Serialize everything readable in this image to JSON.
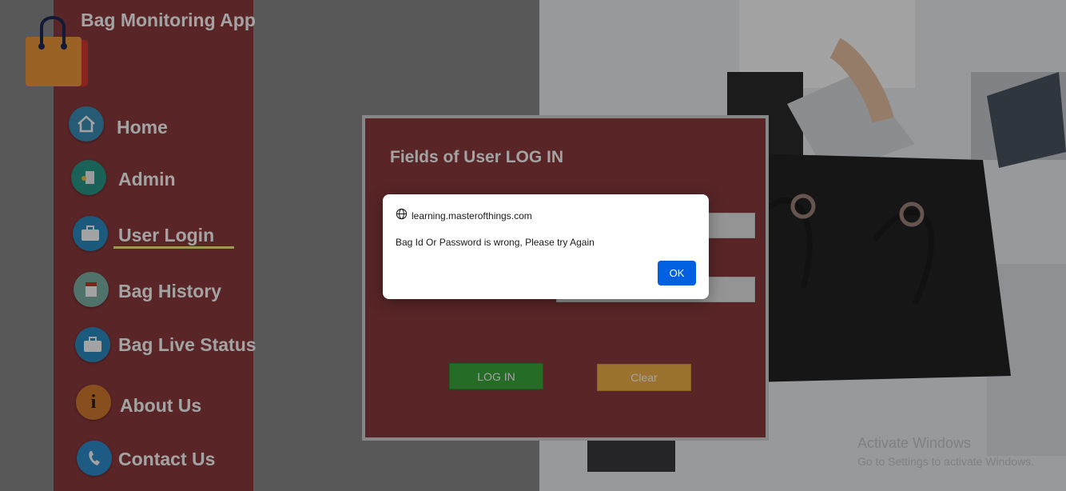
{
  "app": {
    "title": "Bag Monitoring App"
  },
  "sidebar": {
    "items": [
      {
        "label": "Home",
        "icon": "house-icon",
        "color": "#3c8fb8"
      },
      {
        "label": "Admin",
        "icon": "door-key-icon",
        "color": "#2a9a8a"
      },
      {
        "label": "User Login",
        "icon": "briefcase-icon",
        "color": "#2b8ec4",
        "active": true
      },
      {
        "label": "Bag History",
        "icon": "notepad-icon",
        "color": "#7fb3a8"
      },
      {
        "label": "Bag Live Status",
        "icon": "briefcase-icon",
        "color": "#2b8ec4"
      },
      {
        "label": "About Us",
        "icon": "info-icon",
        "color": "#d77a2e"
      },
      {
        "label": "Contact Us",
        "icon": "phone-icon",
        "color": "#2f8fcf"
      }
    ]
  },
  "login": {
    "title": "Fields of User LOG IN",
    "login_button": "LOG IN",
    "clear_button": "Clear"
  },
  "dialog": {
    "origin": "learning.masterofthings.com",
    "message": "Bag Id Or Password is wrong, Please try Again",
    "ok_label": "OK"
  },
  "watermark": {
    "line1": "Activate Windows",
    "line2": "Go to Settings to activate Windows."
  },
  "colors": {
    "sidebar": "#8c3a3e",
    "accent_underline": "#f2ee8a",
    "login_button": "#3aaa3c",
    "clear_button": "#f5b24a",
    "dialog_ok": "#0060df"
  }
}
